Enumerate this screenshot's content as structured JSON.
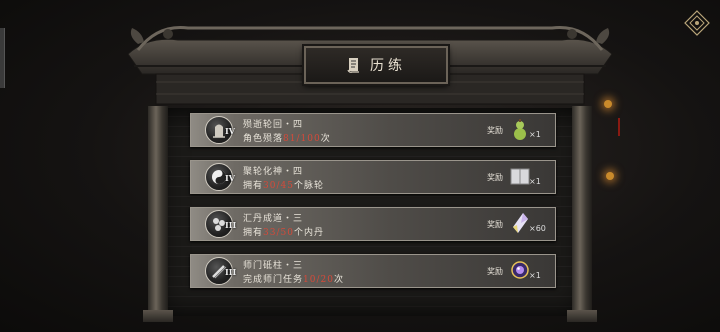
{
  "title": "历练",
  "reward_label": "奖励",
  "tasks": [
    {
      "name": "殒逝轮回・四",
      "tier": "IV",
      "desc_pre": "角色殒落",
      "progress": "81/100",
      "desc_post": "次",
      "reward_icon": "gourd-icon",
      "qty": "×1"
    },
    {
      "name": "聚轮化神・四",
      "tier": "IV",
      "desc_pre": "拥有",
      "progress": "30/45",
      "desc_post": "个脉轮",
      "reward_icon": "scroll-book-icon",
      "qty": "×1"
    },
    {
      "name": "汇丹成道・三",
      "tier": "III",
      "desc_pre": "拥有",
      "progress": "33/50",
      "desc_post": "个内丹",
      "reward_icon": "crystal-icon",
      "qty": "×60"
    },
    {
      "name": "师门砥柱・三",
      "tier": "III",
      "desc_pre": "完成师门任务",
      "progress": "10/20",
      "desc_post": "次",
      "reward_icon": "orb-icon",
      "qty": "×1"
    }
  ],
  "colors": {
    "progress": "#d44a3a",
    "text": "#e9e4da"
  }
}
